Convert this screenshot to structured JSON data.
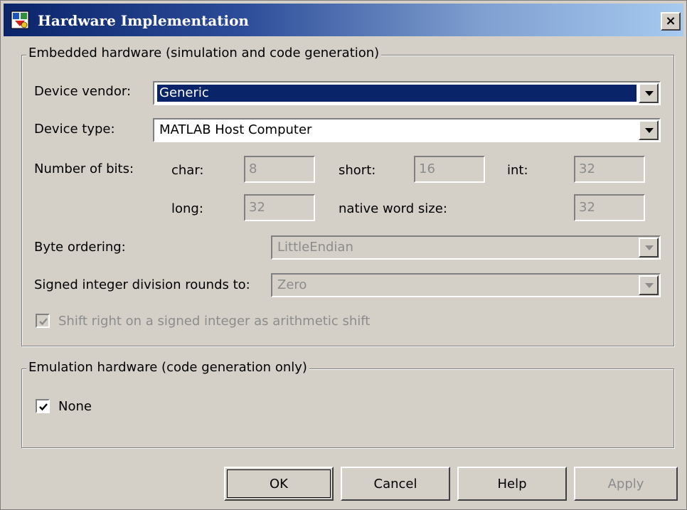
{
  "window": {
    "title": "Hardware Implementation",
    "close_glyph": "×",
    "icon": "simulink-app-icon"
  },
  "embedded": {
    "legend": "Embedded hardware (simulation and code generation)",
    "vendor_label": "Device vendor:",
    "vendor_value": "Generic",
    "type_label": "Device type:",
    "type_value": "MATLAB Host Computer",
    "bits_label": "Number of bits:",
    "char_label": "char:",
    "char_value": "8",
    "short_label": "short:",
    "short_value": "16",
    "int_label": "int:",
    "int_value": "32",
    "long_label": "long:",
    "long_value": "32",
    "native_label": "native word size:",
    "native_value": "32",
    "byte_label": "Byte ordering:",
    "byte_value": "LittleEndian",
    "division_label": "Signed integer division rounds to:",
    "division_value": "Zero",
    "shift_label": "Shift right on a signed integer as arithmetic shift",
    "shift_checked": true
  },
  "emulation": {
    "legend": "Emulation hardware (code generation only)",
    "none_label": "None",
    "none_checked": true
  },
  "buttons": {
    "ok": "OK",
    "cancel": "Cancel",
    "help": "Help",
    "apply": "Apply"
  },
  "colors": {
    "title_start": "#0a246a",
    "title_end": "#a6caf0",
    "dialog_face": "#d4d0c8",
    "selection": "#0a246a",
    "disabled_text": "#8c8c8c"
  }
}
